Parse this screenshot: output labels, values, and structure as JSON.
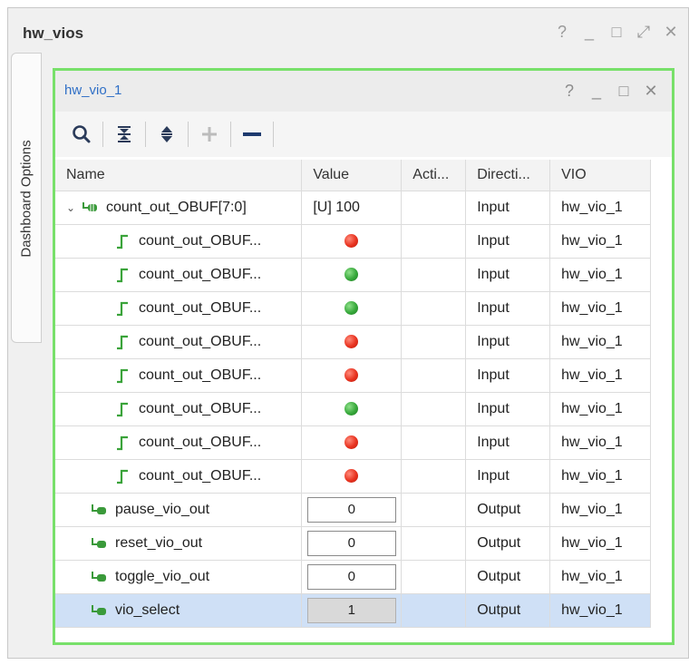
{
  "outer": {
    "title": "hw_vios",
    "controls": [
      "?",
      "_",
      "□",
      "⤢",
      "✕"
    ]
  },
  "side_tab": {
    "label": "Dashboard Options"
  },
  "panel": {
    "title": "hw_vio_1",
    "controls": [
      "?",
      "_",
      "□",
      "✕"
    ],
    "toolbar": [
      "search-icon",
      "collapse-all-icon",
      "expand-all-icon",
      "add-icon",
      "remove-icon"
    ]
  },
  "columns": [
    "Name",
    "Value",
    "Acti...",
    "Directi...",
    "VIO"
  ],
  "rows": [
    {
      "name": "count_out_OBUF[7:0]",
      "value": "[U] 100",
      "direction": "Input",
      "vio": "hw_vio_1"
    },
    {
      "name": "count_out_OBUF...",
      "led": "red",
      "direction": "Input",
      "vio": "hw_vio_1"
    },
    {
      "name": "count_out_OBUF...",
      "led": "green",
      "direction": "Input",
      "vio": "hw_vio_1"
    },
    {
      "name": "count_out_OBUF...",
      "led": "green",
      "direction": "Input",
      "vio": "hw_vio_1"
    },
    {
      "name": "count_out_OBUF...",
      "led": "red",
      "direction": "Input",
      "vio": "hw_vio_1"
    },
    {
      "name": "count_out_OBUF...",
      "led": "red",
      "direction": "Input",
      "vio": "hw_vio_1"
    },
    {
      "name": "count_out_OBUF...",
      "led": "green",
      "direction": "Input",
      "vio": "hw_vio_1"
    },
    {
      "name": "count_out_OBUF...",
      "led": "red",
      "direction": "Input",
      "vio": "hw_vio_1"
    },
    {
      "name": "count_out_OBUF...",
      "led": "red",
      "direction": "Input",
      "vio": "hw_vio_1"
    },
    {
      "name": "pause_vio_out",
      "value": "0",
      "direction": "Output",
      "vio": "hw_vio_1"
    },
    {
      "name": "reset_vio_out",
      "value": "0",
      "direction": "Output",
      "vio": "hw_vio_1"
    },
    {
      "name": "toggle_vio_out",
      "value": "0",
      "direction": "Output",
      "vio": "hw_vio_1"
    },
    {
      "name": "vio_select",
      "value": "1",
      "direction": "Output",
      "vio": "hw_vio_1"
    }
  ],
  "colors": {
    "panel_border": "#78e06a",
    "selected_row": "#cfe0f6",
    "title_blue": "#2f6fc6",
    "led_red": "#e8321f",
    "led_green": "#36a83a"
  }
}
